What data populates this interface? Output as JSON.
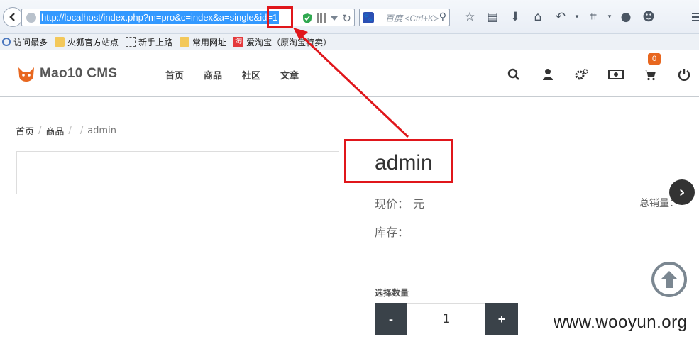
{
  "browser": {
    "url": "http://localhost/index.php?m=pro&c=index&a=single&id=1",
    "search_placeholder": "百度 <Ctrl+K>",
    "toolbar_icons": [
      "star-icon",
      "reading-list-icon",
      "download-icon",
      "home-icon",
      "undo-icon",
      "crop-icon",
      "chat-icon",
      "smiley-icon",
      "menu-icon"
    ],
    "bookmarks": [
      {
        "label": "访问最多",
        "icon": "magnify-icon"
      },
      {
        "label": "火狐官方站点",
        "icon": "folder-icon"
      },
      {
        "label": "新手上路",
        "icon": "page-icon"
      },
      {
        "label": "常用网址",
        "icon": "folder-icon"
      },
      {
        "label": "爱淘宝（原淘宝特卖）",
        "icon": "taobao-icon",
        "badge": "淘"
      }
    ]
  },
  "site": {
    "logo_text": "Mao10 CMS",
    "nav": [
      "首页",
      "商品",
      "社区",
      "文章"
    ],
    "cart_count": "0",
    "nav_icons": [
      "search-icon",
      "user-icon",
      "settings-icon",
      "money-icon",
      "cart-icon",
      "power-icon"
    ]
  },
  "breadcrumb": {
    "items": [
      "首页",
      "商品",
      ""
    ],
    "active": "admin",
    "separator": "/"
  },
  "product": {
    "title": "admin",
    "price_label": "现价：",
    "price_unit": "元",
    "stock_label": "库存：",
    "sales_label": "总销量：",
    "qty_label": "选择数量",
    "qty_value": "1",
    "minus": "-",
    "plus": "+"
  },
  "watermark": "www.wooyun.org",
  "colors": {
    "annotation_red": "#e0161b",
    "url_highlight": "#3399ff",
    "cart_badge": "#e8671f",
    "qty_button": "#3a4249"
  }
}
